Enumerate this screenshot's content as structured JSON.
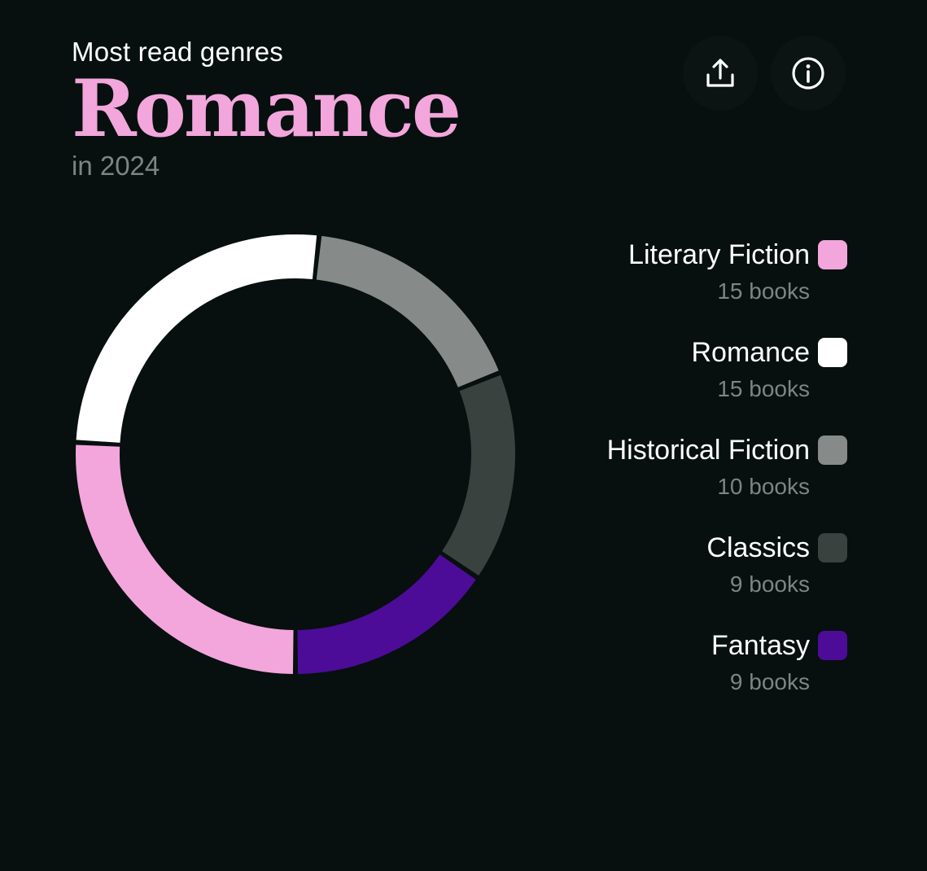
{
  "header": {
    "eyebrow": "Most read genres",
    "title": "Romance",
    "subtitle": "in 2024"
  },
  "actions": {
    "share_icon": "share-icon",
    "info_icon": "info-icon"
  },
  "colors": {
    "background": "#070f0f",
    "accent": "#f2a6db",
    "muted_text": "#7d8483"
  },
  "chart_data": {
    "type": "pie",
    "style": "donut",
    "categories": [
      "Literary Fiction",
      "Romance",
      "Historical Fiction",
      "Classics",
      "Fantasy"
    ],
    "values": [
      15,
      15,
      10,
      9,
      9
    ],
    "value_labels": [
      "15 books",
      "15 books",
      "10 books",
      "9 books",
      "9 books"
    ],
    "colors": [
      "#f2a6db",
      "#ffffff",
      "#868b89",
      "#3a4240",
      "#4c0c97"
    ],
    "legend": "right"
  }
}
